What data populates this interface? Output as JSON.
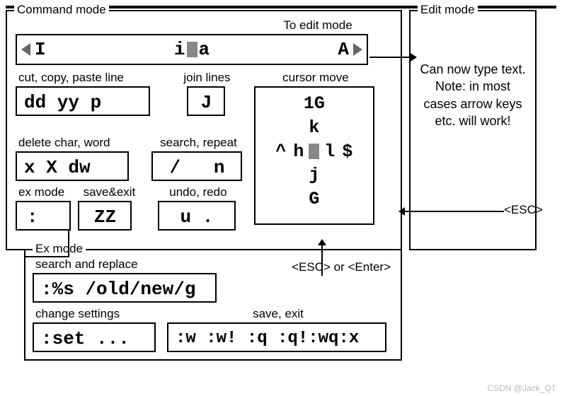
{
  "command_mode": {
    "title": "Command mode",
    "to_edit_label": "To edit mode",
    "edit_row": {
      "I": "I",
      "i": "i",
      "a": "a",
      "A": "A"
    },
    "cut_copy_paste": {
      "label": "cut, copy, paste line",
      "value": "dd yy p"
    },
    "join": {
      "label": "join lines",
      "value": "J"
    },
    "cursor_move": {
      "label": "cursor move",
      "top": "1G",
      "k": "k",
      "caret": "^",
      "h": "h",
      "l": "l",
      "dollar": "$",
      "j": "j",
      "G": "G"
    },
    "delete": {
      "label": "delete char, word",
      "value": "x X dw"
    },
    "search_repeat": {
      "label": "search, repeat",
      "value": "/   n"
    },
    "ex_mode": {
      "label": "ex mode",
      "value": ":"
    },
    "save_exit": {
      "label": "save&exit",
      "value": "ZZ"
    },
    "undo_redo": {
      "label": "undo, redo",
      "value": "u ."
    }
  },
  "ex": {
    "title": "Ex mode",
    "search_replace": {
      "label": "search and replace",
      "value": ":%s /old/new/g"
    },
    "change_settings": {
      "label": "change settings",
      "value": ":set ..."
    },
    "save_exit": {
      "label": "save, exit",
      "value": ":w :w! :q :q!:wq:x"
    },
    "esc_enter": "<ESC> or <Enter>"
  },
  "edit_mode": {
    "title": "Edit mode",
    "text": "Can now type text. Note: in most cases arrow keys etc. will work!",
    "esc": "<ESC>"
  },
  "watermark": "CSDN @Jack_QT"
}
